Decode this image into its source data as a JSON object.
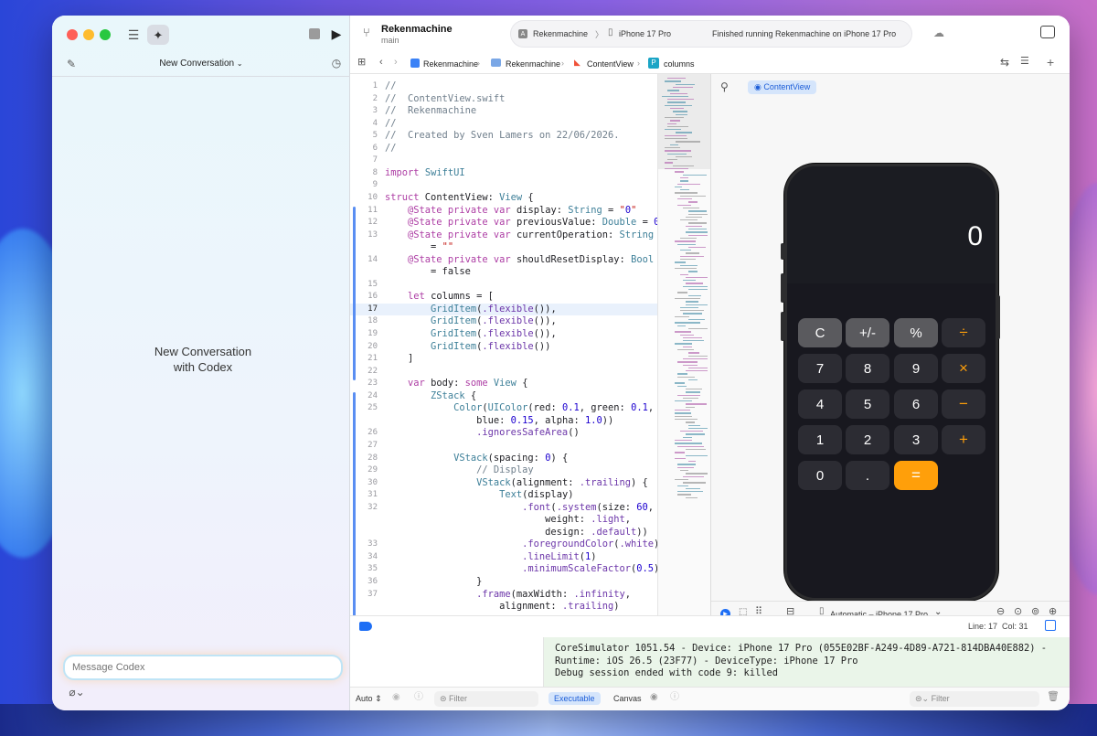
{
  "sidebar": {
    "title": "New Conversation",
    "empty_line1": "New Conversation",
    "empty_line2": "with Codex",
    "message_placeholder": "Message Codex"
  },
  "toolbar": {
    "project_name": "Rekenmachine",
    "branch": "main",
    "scheme": "Rekenmachine",
    "device": "iPhone 17 Pro",
    "status": "Finished running Rekenmachine on iPhone 17 Pro"
  },
  "breadcrumb": {
    "items": [
      "Rekenmachine",
      "Rekenmachine",
      "ContentView",
      "columns"
    ]
  },
  "editor": {
    "lines": [
      {
        "n": "1",
        "t": "//"
      },
      {
        "n": "2",
        "t": "//  ContentView.swift"
      },
      {
        "n": "3",
        "t": "//  Rekenmachine"
      },
      {
        "n": "4",
        "t": "//"
      },
      {
        "n": "5",
        "t": "//  Created by Sven Lamers on 22/06/2026."
      },
      {
        "n": "6",
        "t": "//"
      },
      {
        "n": "7",
        "t": ""
      },
      {
        "n": "8",
        "t": "import SwiftUI"
      },
      {
        "n": "9",
        "t": ""
      },
      {
        "n": "10",
        "t": "struct ContentView: View {"
      },
      {
        "n": "11",
        "t": "    @State private var display: String = \"0\""
      },
      {
        "n": "12",
        "t": "    @State private var previousValue: Double = 0"
      },
      {
        "n": "13",
        "t": "    @State private var currentOperation: String"
      },
      {
        "n": "",
        "t": "        = \"\""
      },
      {
        "n": "14",
        "t": "    @State private var shouldResetDisplay: Bool"
      },
      {
        "n": "",
        "t": "        = false"
      },
      {
        "n": "15",
        "t": ""
      },
      {
        "n": "16",
        "t": "    let columns = ["
      },
      {
        "n": "17",
        "t": "        GridItem(.flexible()),"
      },
      {
        "n": "18",
        "t": "        GridItem(.flexible()),"
      },
      {
        "n": "19",
        "t": "        GridItem(.flexible()),"
      },
      {
        "n": "20",
        "t": "        GridItem(.flexible())"
      },
      {
        "n": "21",
        "t": "    ]"
      },
      {
        "n": "22",
        "t": ""
      },
      {
        "n": "23",
        "t": "    var body: some View {"
      },
      {
        "n": "24",
        "t": "        ZStack {"
      },
      {
        "n": "25",
        "t": "            Color(UIColor(red: 0.1, green: 0.1,"
      },
      {
        "n": "",
        "t": "                blue: 0.15, alpha: 1.0))"
      },
      {
        "n": "26",
        "t": "                .ignoresSafeArea()"
      },
      {
        "n": "27",
        "t": ""
      },
      {
        "n": "28",
        "t": "            VStack(spacing: 0) {"
      },
      {
        "n": "29",
        "t": "                // Display"
      },
      {
        "n": "30",
        "t": "                VStack(alignment: .trailing) {"
      },
      {
        "n": "31",
        "t": "                    Text(display)"
      },
      {
        "n": "32",
        "t": "                        .font(.system(size: 60,"
      },
      {
        "n": "",
        "t": "                            weight: .light,"
      },
      {
        "n": "",
        "t": "                            design: .default))"
      },
      {
        "n": "33",
        "t": "                        .foregroundColor(.white)"
      },
      {
        "n": "34",
        "t": "                        .lineLimit(1)"
      },
      {
        "n": "35",
        "t": "                        .minimumScaleFactor(0.5)"
      },
      {
        "n": "36",
        "t": "                }"
      },
      {
        "n": "37",
        "t": "                .frame(maxWidth: .infinity,"
      },
      {
        "n": "",
        "t": "                    alignment: .trailing)"
      }
    ],
    "status": "Line: 17  Col: 31"
  },
  "preview": {
    "tab": "ContentView",
    "display": "0",
    "buttons": [
      "C",
      "+/-",
      "%",
      "÷",
      "7",
      "8",
      "9",
      "×",
      "4",
      "5",
      "6",
      "−",
      "1",
      "2",
      "3",
      "+",
      "0",
      ".",
      "="
    ],
    "device_selector": "Automatic – iPhone 17 Pro"
  },
  "console": {
    "lines": [
      "CoreSimulator 1051.54 - Device: iPhone 17 Pro (055E02BF-A249-4D89-A721-814DBA40E882) -",
      "Runtime: iOS 26.5 (23F77) - DeviceType: iPhone 17 Pro",
      "Debug session ended with code 9: killed"
    ]
  },
  "bottom": {
    "auto": "Auto",
    "filter1": "Filter",
    "executable": "Executable",
    "canvas": "Canvas",
    "filter2": "Filter"
  }
}
